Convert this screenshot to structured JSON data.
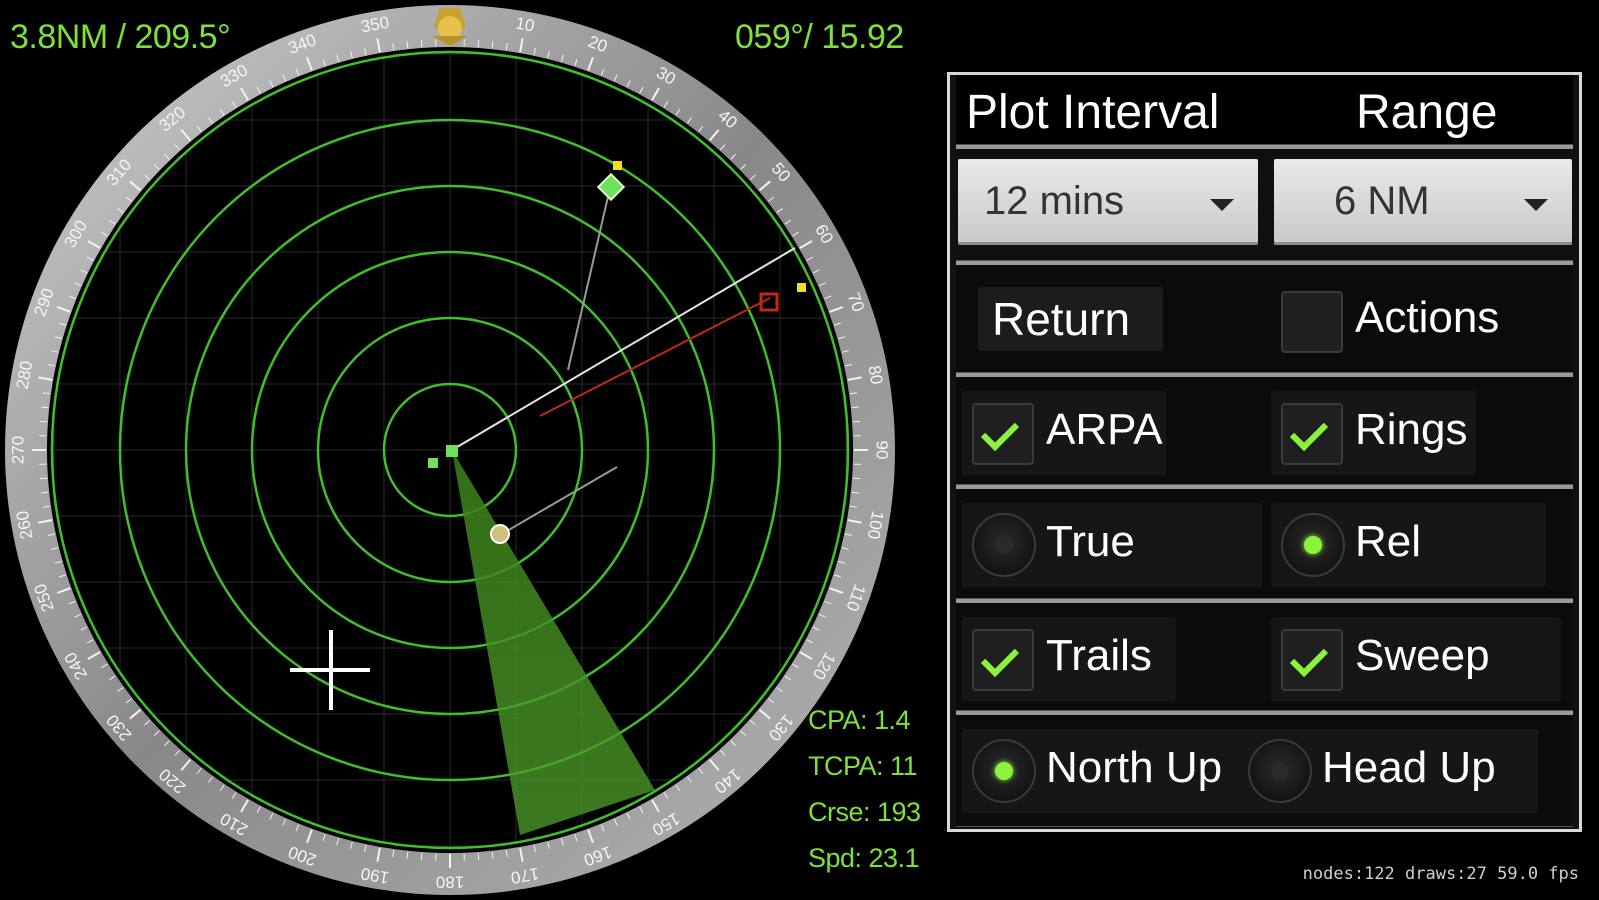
{
  "hud": {
    "cursor_readout": "3.8NM / 209.5°",
    "target_readout": "059°/ 15.92"
  },
  "compass": {
    "tick_labels": [
      "10",
      "20",
      "30",
      "40",
      "50",
      "60",
      "70",
      "80",
      "90",
      "100",
      "110",
      "120",
      "130",
      "140",
      "150",
      "160",
      "170",
      "180",
      "190",
      "200",
      "210",
      "220",
      "230",
      "240",
      "250",
      "260",
      "270",
      "280",
      "290",
      "300",
      "310",
      "320",
      "330",
      "340",
      "350"
    ]
  },
  "target_info": {
    "cpa": "CPA: 1.4",
    "tcpa": "TCPA: 11",
    "crse": "Crse: 193",
    "spd": "Spd: 23.1"
  },
  "status_bar": "nodes:122 draws:27  59.0 fps",
  "panel": {
    "plot_interval_label": "Plot Interval",
    "range_label": "Range",
    "plot_interval_value": "12 mins",
    "range_value": "6 NM",
    "return_label": "Return",
    "actions_label": "Actions",
    "arpa_label": "ARPA",
    "rings_label": "Rings",
    "true_label": "True",
    "rel_label": "Rel",
    "trails_label": "Trails",
    "sweep_label": "Sweep",
    "north_up_label": "North Up",
    "head_up_label": "Head Up"
  },
  "state": {
    "arpa": true,
    "rings": true,
    "actions": false,
    "trails": true,
    "sweep": true,
    "mode": "Rel",
    "orientation": "North Up"
  },
  "colors": {
    "ring_green": "#3fbf2a",
    "hud_green": "#7ee03a",
    "check_green": "#8cf23e",
    "target_yellow": "#f0e020",
    "cpa_red": "#c0281c"
  }
}
